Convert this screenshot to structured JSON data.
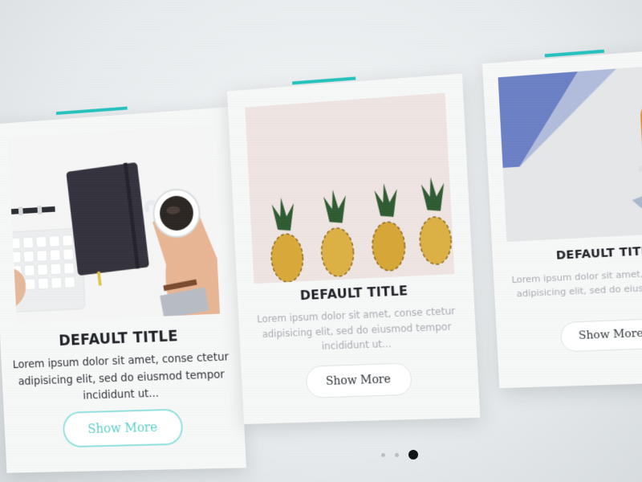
{
  "cards": [
    {
      "title": "DEFAULT TITLE",
      "description": "Lorem ipsum dolor sit amet, conse ctetur adipisicing elit, sed do eiusmod tempor incididunt ut...",
      "button_label": "Show More",
      "image": "desk-notebook-coffee-photo",
      "accent_color": "#24c1bd",
      "button_style": "highlighted"
    },
    {
      "title": "DEFAULT TITLE",
      "description": "Lorem ipsum dolor sit amet, conse ctetur adipisicing elit, sed do eiusmod tempor incididunt ut...",
      "button_label": "Show More",
      "image": "pineapples-photo",
      "accent_color": "#24c1bd",
      "button_style": "default"
    },
    {
      "title": "DEFAULT TITLE",
      "description": "Lorem ipsum dolor sit amet, conse ctetur adipisicing elit, sed do eiusmod tempor",
      "button_label": "Show More",
      "image": "wall-window-photo",
      "accent_color": "#24c1bd",
      "button_style": "default"
    }
  ],
  "pagination": {
    "count": 3,
    "active_index": 2
  },
  "colors": {
    "accent": "#24c1bd",
    "title": "#1e2226",
    "text_muted": "#a7adb2",
    "text_dark": "#2e3338",
    "background": "#eceff1"
  }
}
